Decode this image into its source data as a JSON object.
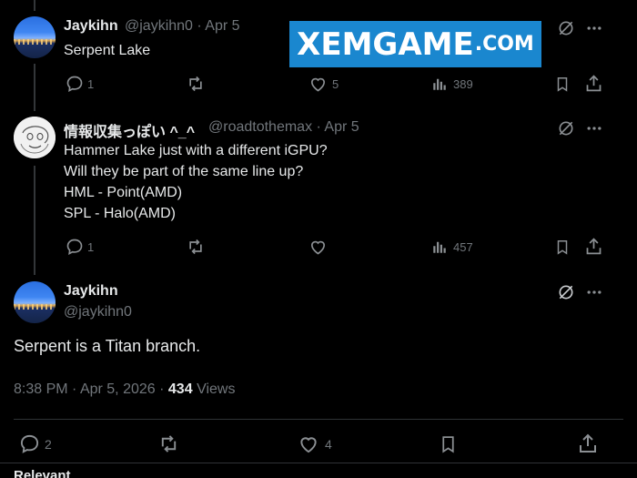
{
  "watermark": {
    "main": "XEMGAME",
    "suffix": ".COM"
  },
  "replies": [
    {
      "display_name": "Jaykihn",
      "handle": "@jaykihn0",
      "separator": "·",
      "date": "Apr 5",
      "lines": [
        "Serpent Lake"
      ],
      "reply_count": "1",
      "like_count": "5",
      "view_count": "389"
    },
    {
      "display_name": "情報収集っぽい ^_^",
      "handle": "@roadtothemax",
      "separator": "·",
      "date": "Apr 5",
      "lines": [
        "Hammer Lake just with a different iGPU?",
        "Will they be part of the same line up?",
        "HML - Point(AMD)",
        "SPL - Halo(AMD)"
      ],
      "reply_count": "1",
      "like_count": "",
      "view_count": "457"
    }
  ],
  "main_post": {
    "display_name": "Jaykihn",
    "handle": "@jaykihn0",
    "text": "Serpent is a Titan branch.",
    "time": "8:38 PM",
    "separator": "·",
    "date": "Apr 5, 2026",
    "separator2": "·",
    "views_count": "434",
    "views_label": "Views",
    "reply_count": "2",
    "like_count": "4"
  },
  "footer": {
    "relevant_label": "Relevant"
  },
  "icons": {
    "reply": "reply-icon",
    "repost": "repost-icon",
    "like": "heart-icon",
    "views": "analytics-icon",
    "bookmark": "bookmark-icon",
    "share": "share-icon",
    "grok": "grok-icon",
    "more": "more-icon"
  },
  "colors": {
    "background": "#000000",
    "text": "#e7e9ea",
    "secondary": "#71767b",
    "divider": "#2f3336",
    "watermark_bg": "#1a87cf"
  }
}
